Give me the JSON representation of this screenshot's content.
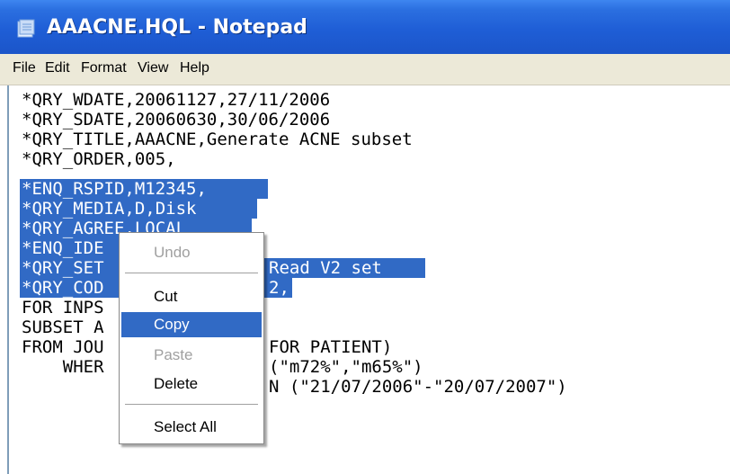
{
  "window": {
    "title": "AAACNE.HQL - Notepad"
  },
  "menu": [
    "File",
    "Edit",
    "Format",
    "View",
    "Help"
  ],
  "editor": {
    "lines": [
      "*QRY_WDATE,20061127,27/11/2006",
      "*QRY_SDATE,20060630,30/06/2006",
      "*QRY_TITLE,AAACNE,Generate ACNE subset",
      "*QRY_ORDER,005,",
      "*ENQ_RSPID,M12345,",
      "*QRY_MEDIA,D,Disk",
      "*QRY_AGREE,LOCAL",
      "*ENQ_IDE",
      "*QRY_SET",
      "*QRY_COD",
      "FOR INPS",
      "SUBSET A",
      "FROM JOU",
      "    WHER",
      ""
    ],
    "right_fragments": {
      "line9": "Read V2 set",
      "line10": "2,",
      "line13": "FOR PATIENT)",
      "line14": "(\"m72%\",\"m65%\")",
      "line15": "N (\"21/07/2006\"-\"20/07/2007\")"
    }
  },
  "context_menu": {
    "items": [
      {
        "label": "Undo",
        "state": "disabled"
      },
      {
        "label": "Cut",
        "state": "enabled"
      },
      {
        "label": "Copy",
        "state": "highlighted"
      },
      {
        "label": "Paste",
        "state": "disabled"
      },
      {
        "label": "Delete",
        "state": "enabled"
      },
      {
        "label": "Select All",
        "state": "enabled"
      }
    ]
  },
  "colors": {
    "titlebar": "#1f5ed6",
    "selection": "#316ac5",
    "menubar": "#ece9d8"
  },
  "icons": {
    "app_icon": "notepad-icon"
  }
}
